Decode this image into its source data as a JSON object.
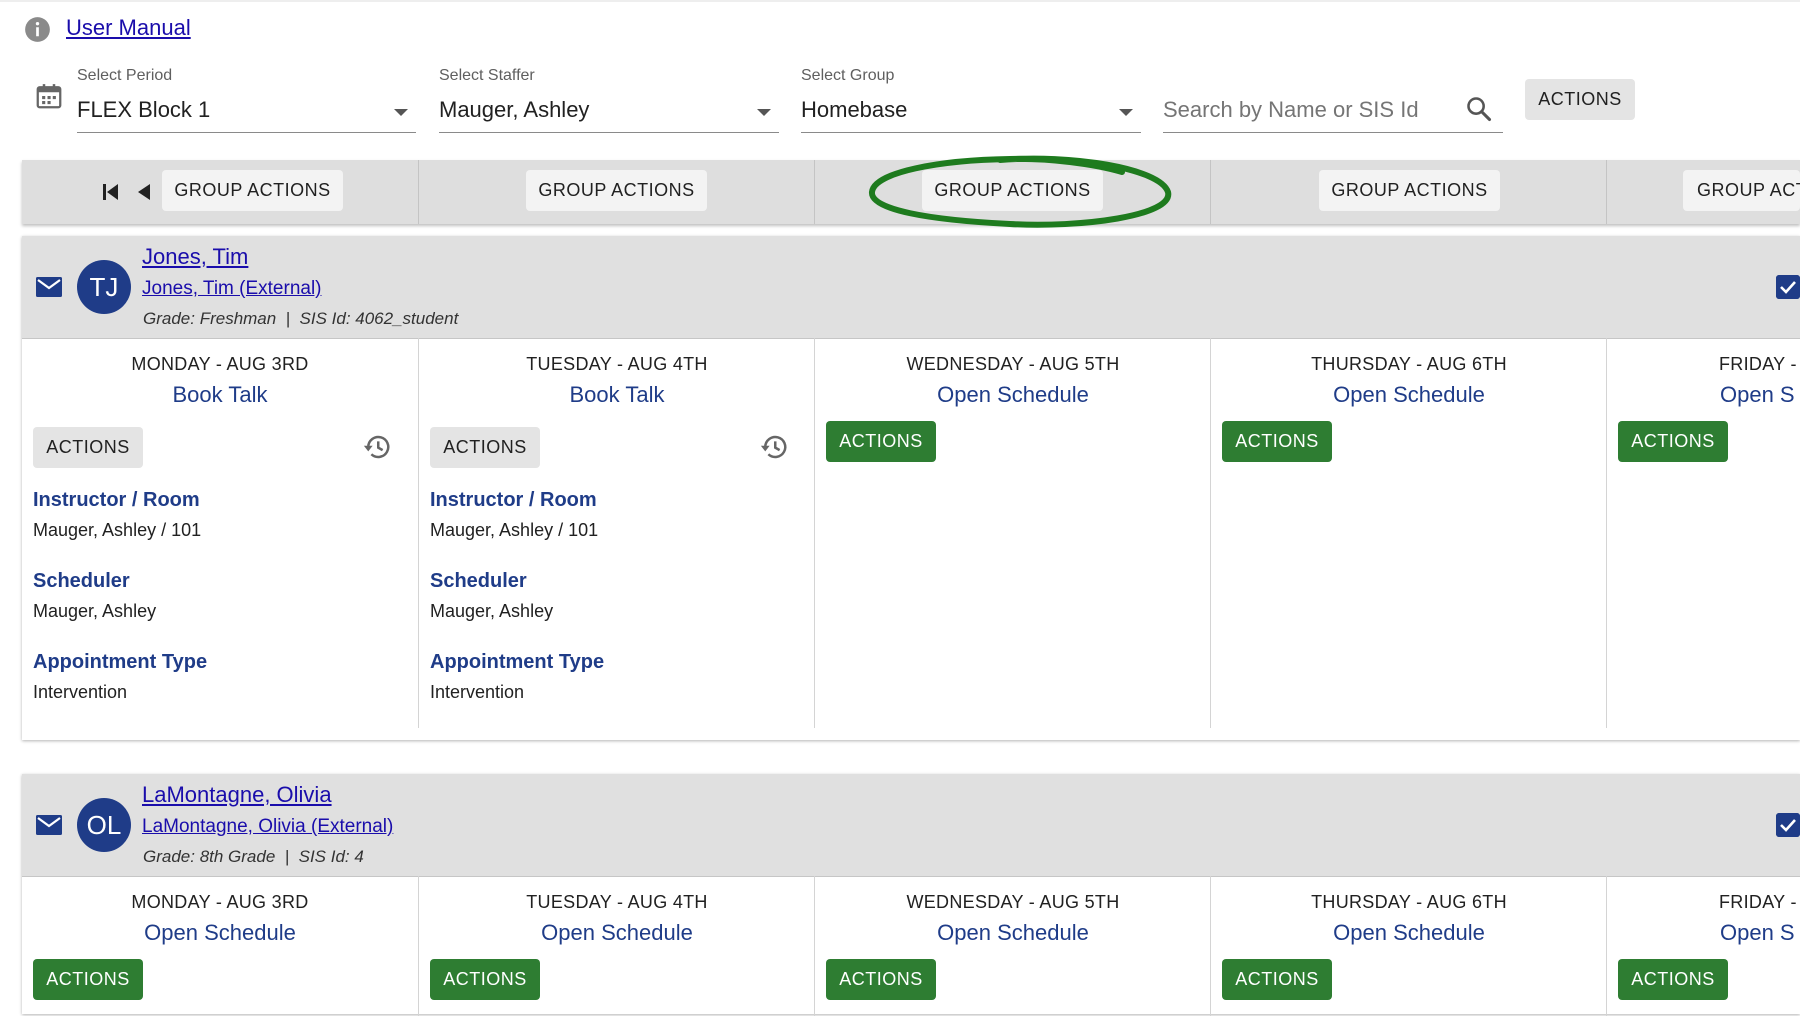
{
  "header": {
    "manual_link": "User Manual",
    "icon": "info-icon"
  },
  "filters": {
    "period": {
      "label": "Select Period",
      "value": "FLEX Block 1"
    },
    "staffer": {
      "label": "Select Staffer",
      "value": "Mauger, Ashley"
    },
    "group": {
      "label": "Select Group",
      "value": "Homebase"
    },
    "search": {
      "placeholder": "Search by Name or SIS Id"
    },
    "actions_label": "ACTIONS"
  },
  "group_bar": {
    "buttons": [
      "GROUP ACTIONS",
      "GROUP ACTIONS",
      "GROUP ACTIONS",
      "GROUP ACTIONS",
      "GROUP ACT"
    ]
  },
  "colors": {
    "primary": "#1f3c88",
    "link": "#1a0dab",
    "action_green": "#2e7d32",
    "annotation_circle": "#1e7b1e"
  },
  "students": [
    {
      "name": "Jones, Tim",
      "external": "Jones, Tim (External)",
      "initials": "TJ",
      "meta": "Grade: Freshman  |  SIS Id: 4062_student",
      "days": [
        {
          "day": "MONDAY - AUG 3RD",
          "schedule": "Book Talk",
          "actions": "ACTIONS",
          "instructor_label": "Instructor / Room",
          "instructor": "Mauger, Ashley / 101",
          "scheduler_label": "Scheduler",
          "scheduler": "Mauger, Ashley",
          "type_label": "Appointment Type",
          "type": "Intervention"
        },
        {
          "day": "TUESDAY - AUG 4TH",
          "schedule": "Book Talk",
          "actions": "ACTIONS",
          "instructor_label": "Instructor / Room",
          "instructor": "Mauger, Ashley / 101",
          "scheduler_label": "Scheduler",
          "scheduler": "Mauger, Ashley",
          "type_label": "Appointment Type",
          "type": "Intervention"
        },
        {
          "day": "WEDNESDAY - AUG 5TH",
          "schedule": "Open Schedule",
          "actions": "ACTIONS"
        },
        {
          "day": "THURSDAY - AUG 6TH",
          "schedule": "Open Schedule",
          "actions": "ACTIONS"
        },
        {
          "day": "FRIDAY -",
          "schedule": "Open S",
          "actions": "ACTIONS"
        }
      ]
    },
    {
      "name": "LaMontagne, Olivia",
      "external": "LaMontagne, Olivia (External)",
      "initials": "OL",
      "meta": "Grade: 8th Grade  |  SIS Id: 4",
      "days": [
        {
          "day": "MONDAY - AUG 3RD",
          "schedule": "Open Schedule",
          "actions": "ACTIONS"
        },
        {
          "day": "TUESDAY - AUG 4TH",
          "schedule": "Open Schedule",
          "actions": "ACTIONS"
        },
        {
          "day": "WEDNESDAY - AUG 5TH",
          "schedule": "Open Schedule",
          "actions": "ACTIONS"
        },
        {
          "day": "THURSDAY - AUG 6TH",
          "schedule": "Open Schedule",
          "actions": "ACTIONS"
        },
        {
          "day": "FRIDAY -",
          "schedule": "Open S",
          "actions": "ACTIONS"
        }
      ]
    }
  ]
}
